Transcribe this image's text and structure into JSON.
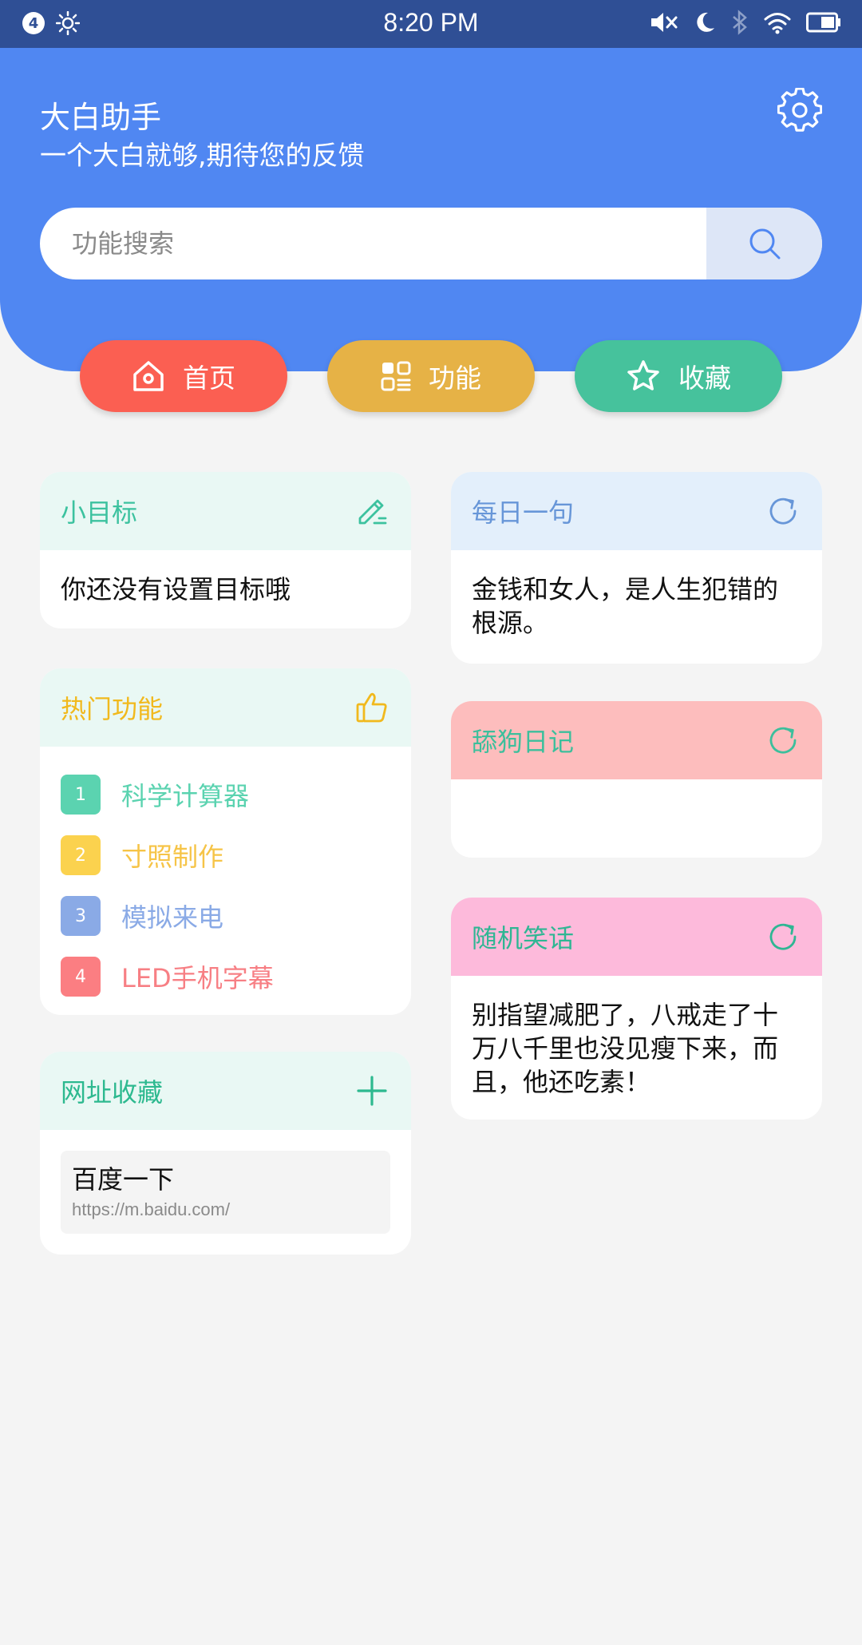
{
  "status_bar": {
    "notification_count": "4",
    "time": "8:20 PM"
  },
  "header": {
    "title": "大白助手",
    "subtitle": "一个大白就够,期待您的反馈"
  },
  "search": {
    "placeholder": "功能搜索"
  },
  "tabs": [
    {
      "label": "首页",
      "color": "#fb5f52",
      "icon": "home-icon"
    },
    {
      "label": "功能",
      "color": "#e6b246",
      "icon": "grid-icon"
    },
    {
      "label": "收藏",
      "color": "#46c29c",
      "icon": "star-icon"
    }
  ],
  "goal_card": {
    "title": "小目标",
    "title_color": "#3cc29f",
    "header_bg": "#e9f8f4",
    "body": "你还没有设置目标哦"
  },
  "hot_card": {
    "title": "热门功能",
    "title_color": "#f1b91d",
    "header_bg": "#e9f8f4",
    "items": [
      {
        "num": "1",
        "name": "科学计算器",
        "color": "#5bd3b0",
        "text_color": "#5bd3b0"
      },
      {
        "num": "2",
        "name": "寸照制作",
        "color": "#fbd24e",
        "text_color": "#f6c447"
      },
      {
        "num": "3",
        "name": "模拟来电",
        "color": "#8aaae6",
        "text_color": "#8aaae6"
      },
      {
        "num": "4",
        "name": "LED手机字幕",
        "color": "#fb7e82",
        "text_color": "#f77f84"
      }
    ]
  },
  "url_card": {
    "title": "网址收藏",
    "title_color": "#2db98f",
    "header_bg": "#e9f8f4",
    "links": [
      {
        "title": "百度一下",
        "url": "https://m.baidu.com/"
      }
    ]
  },
  "quote_card": {
    "title": "每日一句",
    "title_color": "#6796d8",
    "header_bg": "#e3effb",
    "body": "金钱和女人，是人生犯错的根源。"
  },
  "diary_card": {
    "title": "舔狗日记",
    "title_color": "#3cbf9c",
    "header_bg": "#fdbdbd",
    "body": ""
  },
  "joke_card": {
    "title": "随机笑话",
    "title_color": "#2fb693",
    "header_bg": "#fdbadb",
    "body": "别指望减肥了，八戒走了十万八千里也没见瘦下来，而且，他还吃素！"
  }
}
